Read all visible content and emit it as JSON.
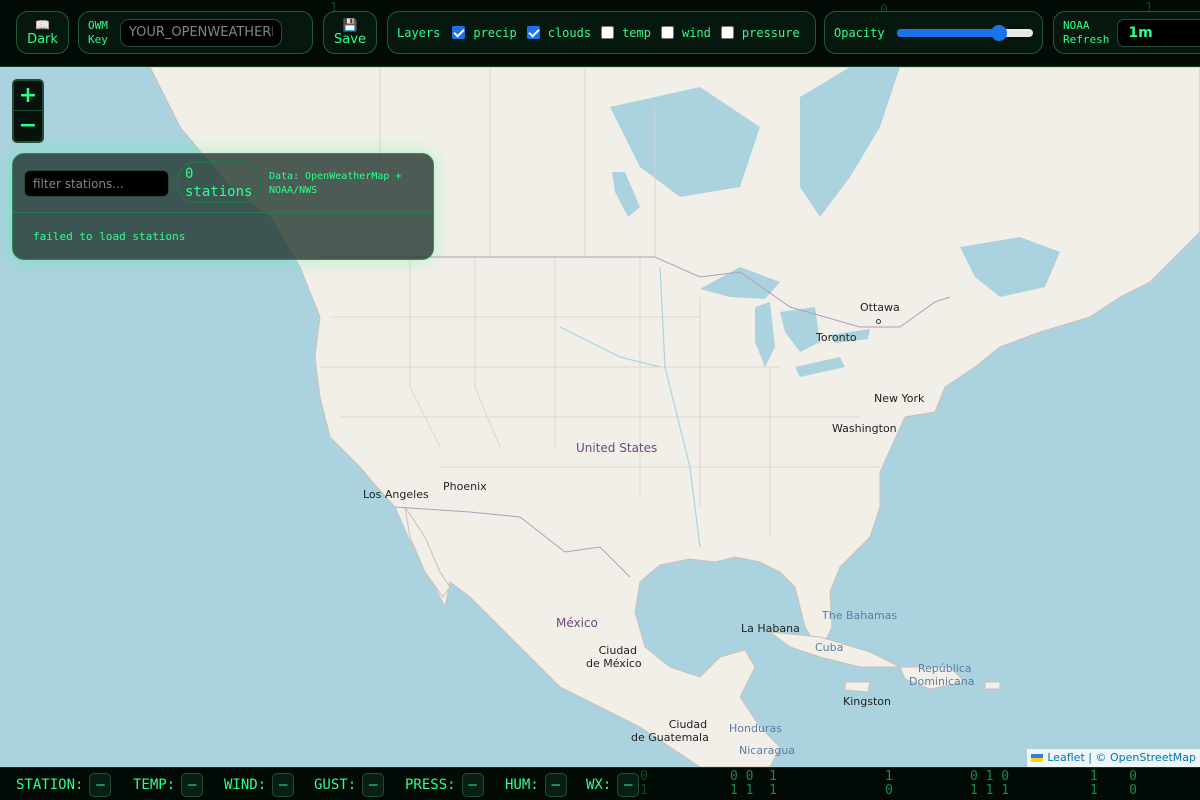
{
  "toolbar": {
    "theme_button": {
      "label": "Dark",
      "icon": "book-icon"
    },
    "owm_key": {
      "label_line1": "OWM",
      "label_line2": "Key",
      "placeholder": "YOUR_OPENWEATHERMAP_KEY"
    },
    "save_button": {
      "label": "Save",
      "icon": "floppy-icon"
    },
    "layers": {
      "label": "Layers",
      "items": [
        {
          "label": "precip",
          "checked": true
        },
        {
          "label": "clouds",
          "checked": true
        },
        {
          "label": "temp",
          "checked": false
        },
        {
          "label": "wind",
          "checked": false
        },
        {
          "label": "pressure",
          "checked": false
        }
      ]
    },
    "opacity": {
      "label": "Opacity",
      "value": 0.75
    },
    "noaa_refresh": {
      "label_line1": "NOAA",
      "label_line2": "Refresh",
      "selected": "1m"
    }
  },
  "map": {
    "zoom_in_label": "+",
    "zoom_out_label": "−",
    "labels": {
      "ottawa": "Ottawa",
      "toronto": "Toronto",
      "new_york": "New York",
      "washington": "Washington",
      "united_states": "United States",
      "phoenix": "Phoenix",
      "los_angeles": "Los Angeles",
      "mexico": "México",
      "ciudad_de_mexico_1": "Ciudad",
      "ciudad_de_mexico_2": "de México",
      "la_habana": "La Habana",
      "the_bahamas": "The Bahamas",
      "cuba": "Cuba",
      "republica_1": "República",
      "republica_2": "Dominicana",
      "kingston": "Kingston",
      "guatemala_1": "Ciudad",
      "guatemala_2": "de Guatemala",
      "honduras": "Honduras",
      "nicaragua": "Nicaragua"
    },
    "attribution": {
      "leaflet": "Leaflet",
      "separator": " | © ",
      "osm": "OpenStreetMap"
    }
  },
  "station_panel": {
    "filter_placeholder": "filter stations...",
    "count_value": "0",
    "count_unit": "stations",
    "data_source": "Data: OpenWeatherMap + NOAA/NWS",
    "status": "failed to load stations"
  },
  "bottom_bar": {
    "fields": [
      {
        "label": "STATION:",
        "value": "—"
      },
      {
        "label": "TEMP:",
        "value": "—"
      },
      {
        "label": "WIND:",
        "value": "—"
      },
      {
        "label": "GUST:",
        "value": "—"
      },
      {
        "label": "PRESS:",
        "value": "—"
      },
      {
        "label": "HUM:",
        "value": "—"
      },
      {
        "label": "WX:",
        "value": "—"
      }
    ]
  },
  "colors": {
    "accent": "#2dff8c",
    "water": "#aad3df",
    "land": "#f2efe9",
    "checkbox": "#1a73e8"
  }
}
